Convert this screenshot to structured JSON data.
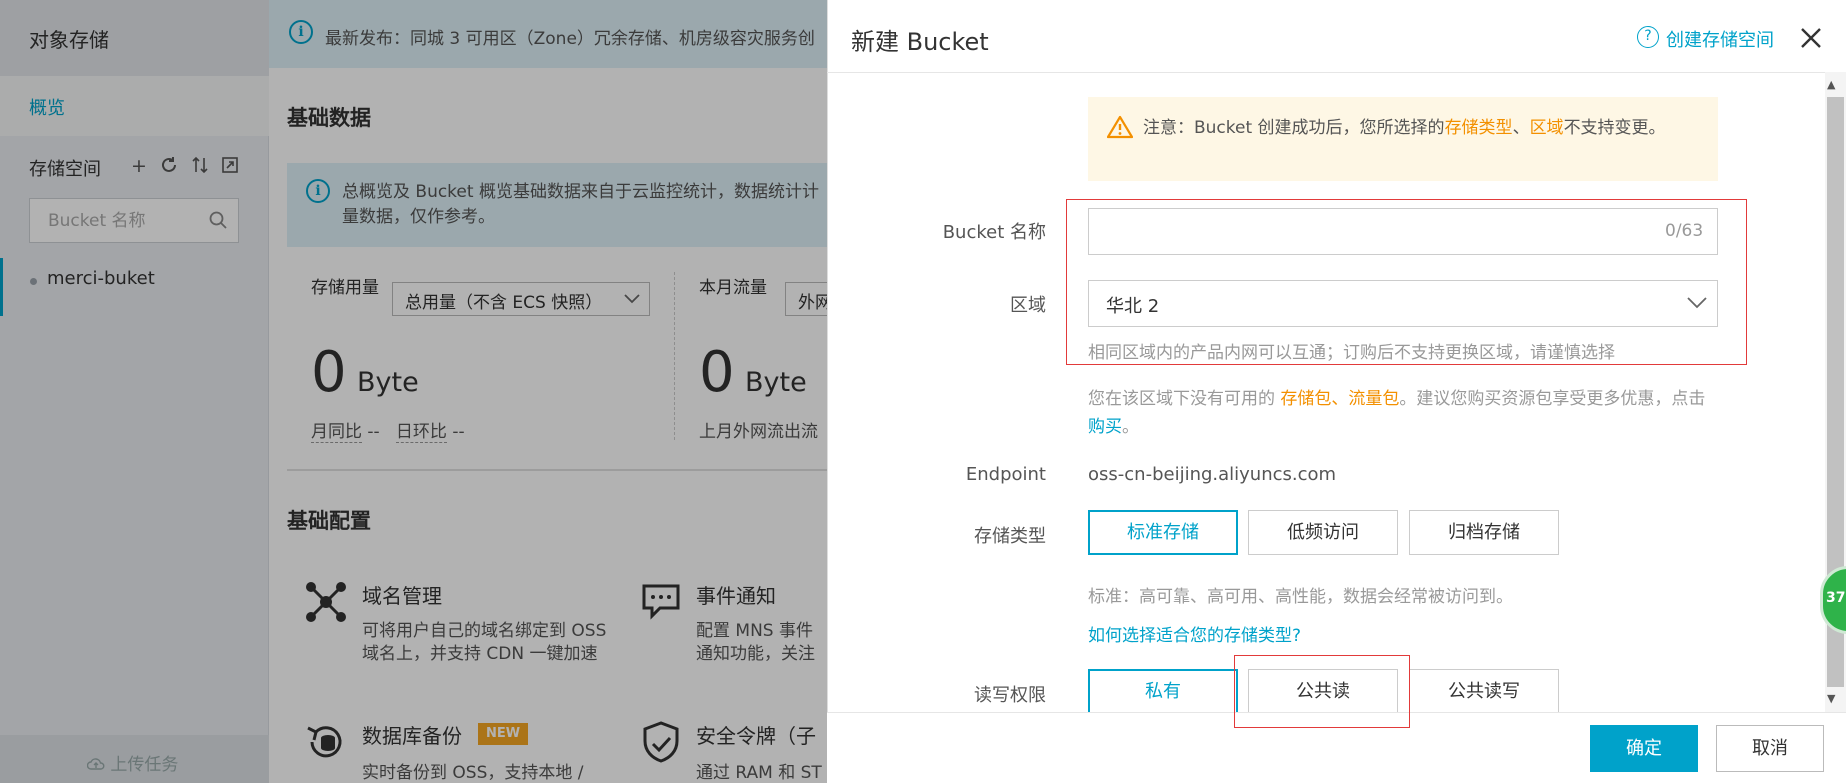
{
  "sidebar": {
    "title": "对象存储",
    "overview": "概览",
    "buckets_label": "存储空间",
    "search_placeholder": "Bucket 名称",
    "bucket_name": "merci-buket",
    "upload_tasks": "上传任务"
  },
  "main": {
    "banner": "最新发布：同城 3 可用区（Zone）冗余存储、机房级容灾服务创",
    "basic_title": "基础数据",
    "info": "总概览及 Bucket 概览基础数据来自于云监控统计，数据统计计量数据，仅作参考。",
    "storage": {
      "label": "存储用量",
      "select": "总用量（不含 ECS 快照）",
      "value": "0",
      "unit": "Byte",
      "compare_mom": "月同比",
      "compare_mom_val": "--",
      "compare_dod": "日环比",
      "compare_dod_val": "--"
    },
    "traffic": {
      "label": "本月流量",
      "select": "外网",
      "value": "0",
      "unit": "Byte",
      "compare": "上月外网流出流"
    },
    "config_title": "基础配置",
    "features": [
      {
        "title": "域名管理",
        "desc": "可将用户自己的域名绑定到 OSS 域名上，并支持 CDN 一键加速"
      },
      {
        "title": "事件通知",
        "desc": "配置 MNS 事件通知功能，关注 Buck"
      },
      {
        "title": "数据库备份",
        "desc": "实时备份到 OSS，支持本地 /",
        "badge": "NEW"
      },
      {
        "title": "安全令牌（子",
        "desc": "通过 RAM 和 ST"
      }
    ]
  },
  "modal": {
    "title": "新建 Bucket",
    "help_link": "创建存储空间",
    "warning": {
      "prefix": "注意：Bucket 创建成功后，您所选择的",
      "storage_class": "存储类型",
      "sep": "、",
      "region": "区域",
      "suffix": "不支持变更。"
    },
    "name_label": "Bucket 名称",
    "name_counter": "0/63",
    "region_label": "区域",
    "region_value": "华北 2",
    "region_hint": "相同区域内的产品内网可以互通；订购后不支持更换区域，请谨慎选择",
    "pkg_notice": {
      "prefix": "您在该区域下没有可用的 ",
      "storage_pkg": "存储包",
      "sep": "、",
      "traffic_pkg": "流量包",
      "middle": "。建议您购买资源包享受更多优惠，点击 ",
      "buy": "购买",
      "suffix": "。"
    },
    "endpoint_label": "Endpoint",
    "endpoint_value": "oss-cn-beijing.aliyuncs.com",
    "class_label": "存储类型",
    "class_options": [
      "标准存储",
      "低频访问",
      "归档存储"
    ],
    "class_selected": "标准存储",
    "class_desc": "标准：高可靠、高可用、高性能，数据会经常被访问到。",
    "class_help": "如何选择适合您的存储类型?",
    "acl_label": "读写权限",
    "acl_options": [
      "私有",
      "公共读",
      "公共读写"
    ],
    "acl_selected": "私有",
    "ok": "确定",
    "cancel": "取消"
  },
  "float_badge": "37",
  "colors": {
    "accent": "#00a2ca",
    "warning_orange": "#f39000",
    "annotation_red": "#e23a3a",
    "badge_green": "#2fb34a"
  }
}
